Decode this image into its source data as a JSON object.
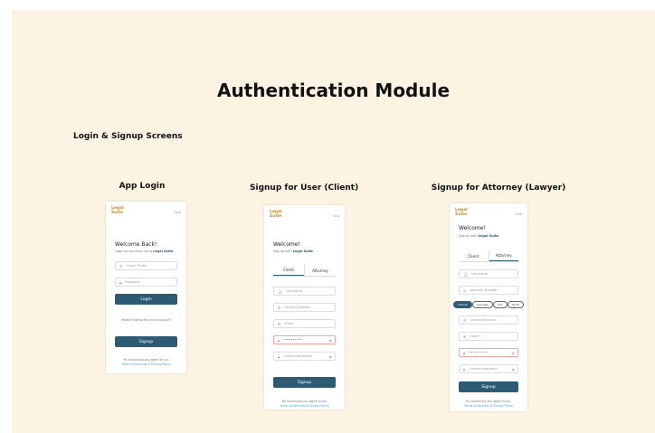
{
  "main_title": "Authentication Module",
  "section_title": "Login & Signup Screens",
  "screens": {
    "login": {
      "title": "App Login",
      "logo_line1": "Legal",
      "logo_line2": "Suite",
      "skip": "Skip",
      "welcome": "Welcome Back!",
      "sub_prefix": "Login to continue using ",
      "sub_brand": "Legal Suite",
      "phone_placeholder": "Phone Phone",
      "password_placeholder": "Password",
      "login_button": "Login",
      "no_account": "Haven't signup for a new account?",
      "signup_button": "Signup",
      "terms_line1": "By continuing you agree to our",
      "terms_link1": "Terms of Services",
      "terms_amp": " & ",
      "terms_link2": "Privacy Policy"
    },
    "client": {
      "title": "Signup for User (Client)",
      "logo_line1": "Legal",
      "logo_line2": "Suite",
      "skip": "Skip",
      "welcome": "Welcome!",
      "sub_prefix": "Signup with ",
      "sub_brand": "Legal Suite",
      "tab_client": "Client",
      "tab_attorney": "Attorney",
      "f_username": "Username",
      "f_phone": "Contact Number",
      "f_email": "Email",
      "f_password": "••••••••••",
      "f_confirm": "Confirm password",
      "signup_button": "Signup",
      "terms_line1": "By continuing you agree to our",
      "terms_link1": "Terms of Services",
      "terms_amp": " & ",
      "terms_link2": "Privacy Policy"
    },
    "attorney": {
      "title": "Signup for Attorney (Lawyer)",
      "logo_line1": "Legal",
      "logo_line2": "Suite",
      "skip": "Skip",
      "welcome": "Welcome!",
      "sub_prefix": "Signup with ",
      "sub_brand": "Legal Suite",
      "tab_client": "Client",
      "tab_attorney": "Attorney",
      "f_username": "Username",
      "f_attorney_number": "Attorney Number",
      "pills": [
        "Criminal",
        "Corporate",
        "Civil",
        "Family"
      ],
      "f_phone": "Contact Number",
      "f_email": "Email",
      "f_password": "••••••••••",
      "f_confirm": "Confirm password",
      "signup_button": "Signup",
      "terms_line1": "By continuing you agree to our",
      "terms_link1": "Terms of Services",
      "terms_amp": " & ",
      "terms_link2": "Privacy Policy"
    }
  },
  "colors": {
    "background": "#fdf3e3",
    "primary": "#2d5b73",
    "logo": "#c98a1a",
    "link": "#3aa4d6",
    "error": "#d84b4b"
  }
}
